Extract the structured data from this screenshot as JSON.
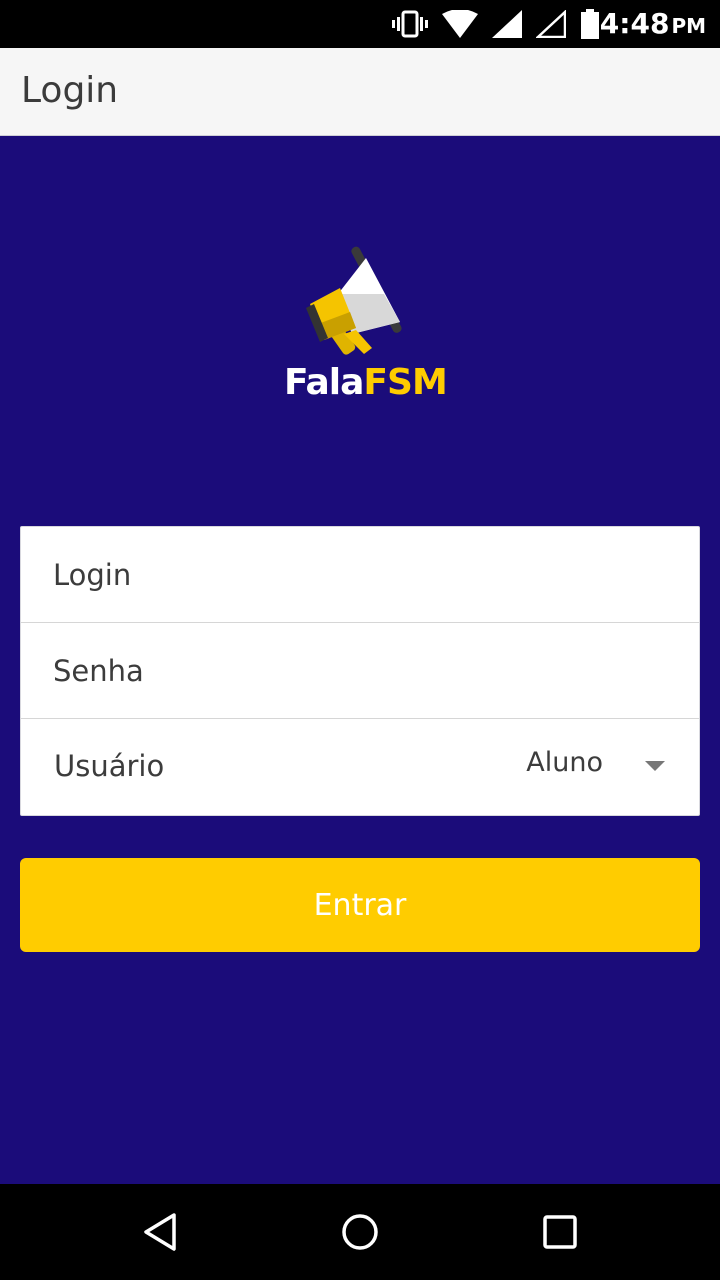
{
  "status_bar": {
    "time": "4:48",
    "ampm": "PM",
    "icons": [
      "vibrate-icon",
      "wifi-icon",
      "signal-icon",
      "signal-empty-icon",
      "battery-icon"
    ]
  },
  "app_bar": {
    "title": "Login"
  },
  "logo": {
    "text_white": "Fala",
    "text_yellow": "FSM",
    "icon": "megaphone-icon"
  },
  "form": {
    "login_placeholder": "Login",
    "password_placeholder": "Senha",
    "user_type_label": "Usuário",
    "user_type_value": "Aluno"
  },
  "actions": {
    "submit_label": "Entrar"
  },
  "nav_bar": {
    "icons": [
      "back-icon",
      "home-icon",
      "recents-icon"
    ]
  },
  "colors": {
    "background": "#1b0c7a",
    "accent": "#ffcc00",
    "app_bar": "#f6f6f6"
  }
}
